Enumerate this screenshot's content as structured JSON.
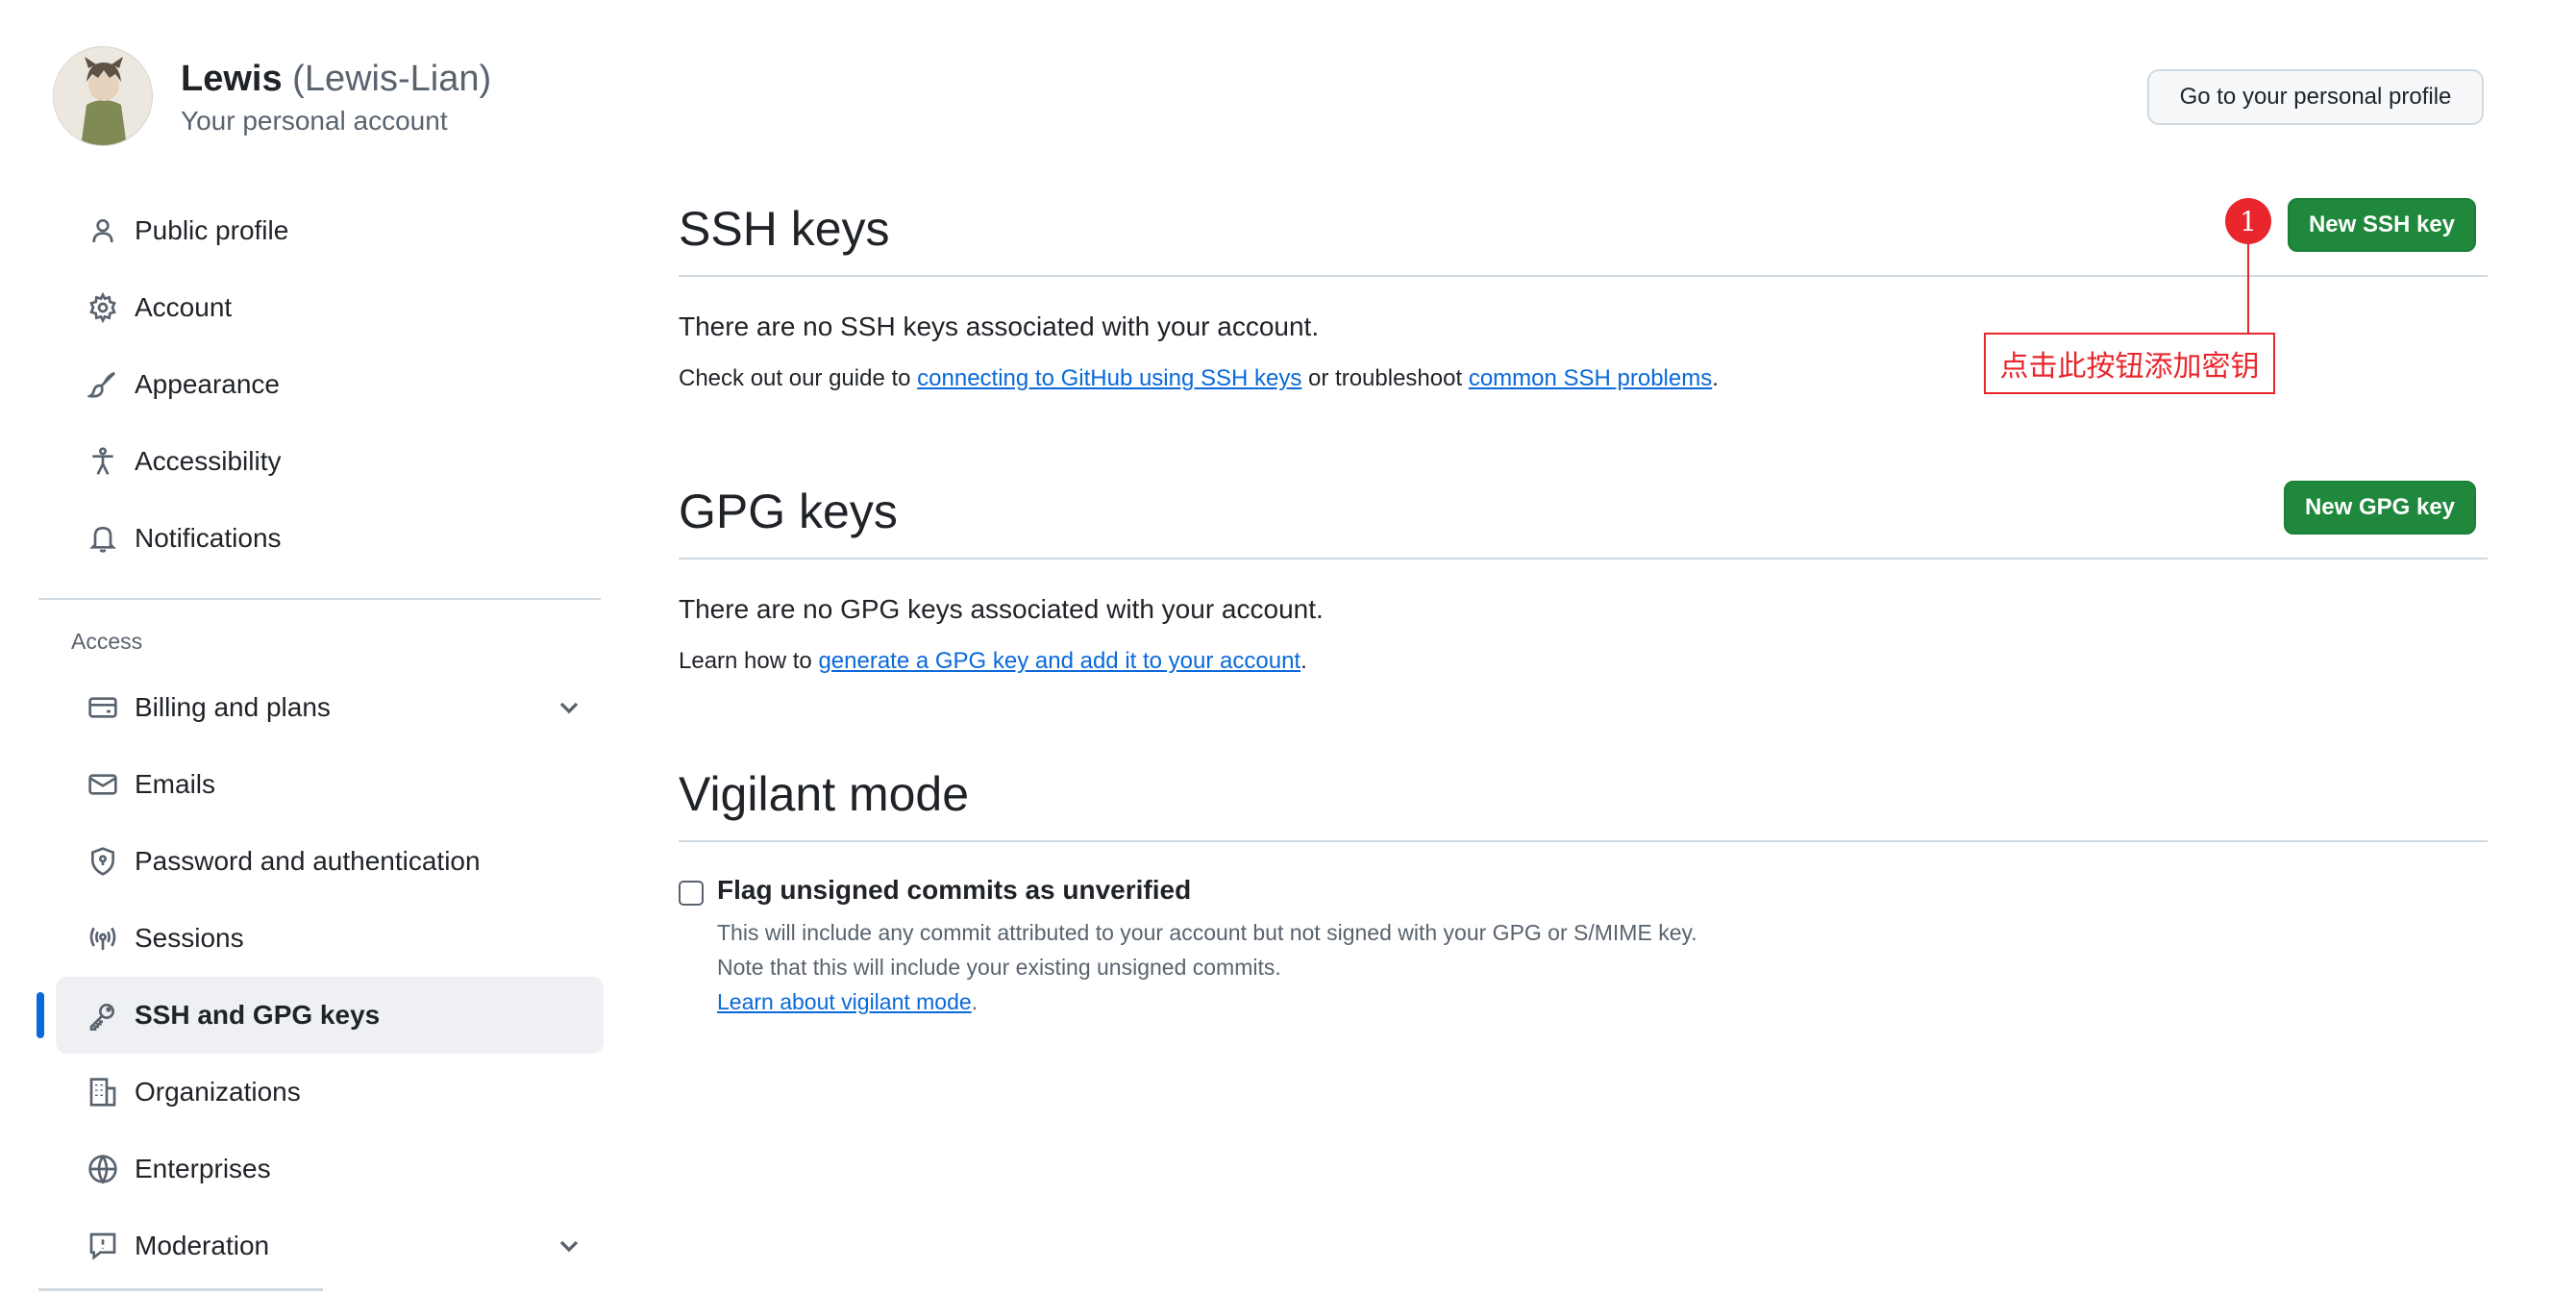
{
  "user": {
    "display_name": "Lewis",
    "login": "(Lewis-Lian)",
    "subtitle": "Your personal account",
    "profile_button": "Go to your personal profile"
  },
  "sidebar": {
    "items": [
      {
        "label": "Public profile",
        "icon": "person-icon"
      },
      {
        "label": "Account",
        "icon": "gear-icon"
      },
      {
        "label": "Appearance",
        "icon": "paintbrush-icon"
      },
      {
        "label": "Accessibility",
        "icon": "accessibility-icon"
      },
      {
        "label": "Notifications",
        "icon": "bell-icon"
      }
    ],
    "access_group_title": "Access",
    "access_items": [
      {
        "label": "Billing and plans",
        "icon": "credit-card-icon"
      },
      {
        "label": "Emails",
        "icon": "mail-icon"
      },
      {
        "label": "Password and authentication",
        "icon": "shield-icon"
      },
      {
        "label": "Sessions",
        "icon": "broadcast-icon"
      },
      {
        "label": "SSH and GPG keys",
        "icon": "key-icon"
      },
      {
        "label": "Organizations",
        "icon": "organization-icon"
      },
      {
        "label": "Enterprises",
        "icon": "globe-icon"
      },
      {
        "label": "Moderation",
        "icon": "report-icon"
      }
    ]
  },
  "ssh": {
    "title": "SSH keys",
    "button": "New SSH key",
    "empty": "There are no SSH keys associated with your account.",
    "help_prefix": "Check out our guide to ",
    "help_link1": "connecting to GitHub using SSH keys",
    "help_mid": " or troubleshoot ",
    "help_link2": "common SSH problems",
    "help_suffix": "."
  },
  "gpg": {
    "title": "GPG keys",
    "button": "New GPG key",
    "empty": "There are no GPG keys associated with your account.",
    "help_prefix": "Learn how to ",
    "help_link": "generate a GPG key and add it to your account",
    "help_suffix": "."
  },
  "vigilant": {
    "title": "Vigilant mode",
    "checkbox_label": "Flag unsigned commits as unverified",
    "note1": "This will include any commit attributed to your account but not signed with your GPG or S/MIME key.",
    "note2": "Note that this will include your existing unsigned commits.",
    "link": "Learn about vigilant mode",
    "link_suffix": "."
  },
  "annotation": {
    "number": "1",
    "text": "点击此按钮添加密钥",
    "color": "#e8262c"
  },
  "colors": {
    "primary_button": "#1f883d",
    "link": "#0969da",
    "active_indicator": "#0969da"
  }
}
